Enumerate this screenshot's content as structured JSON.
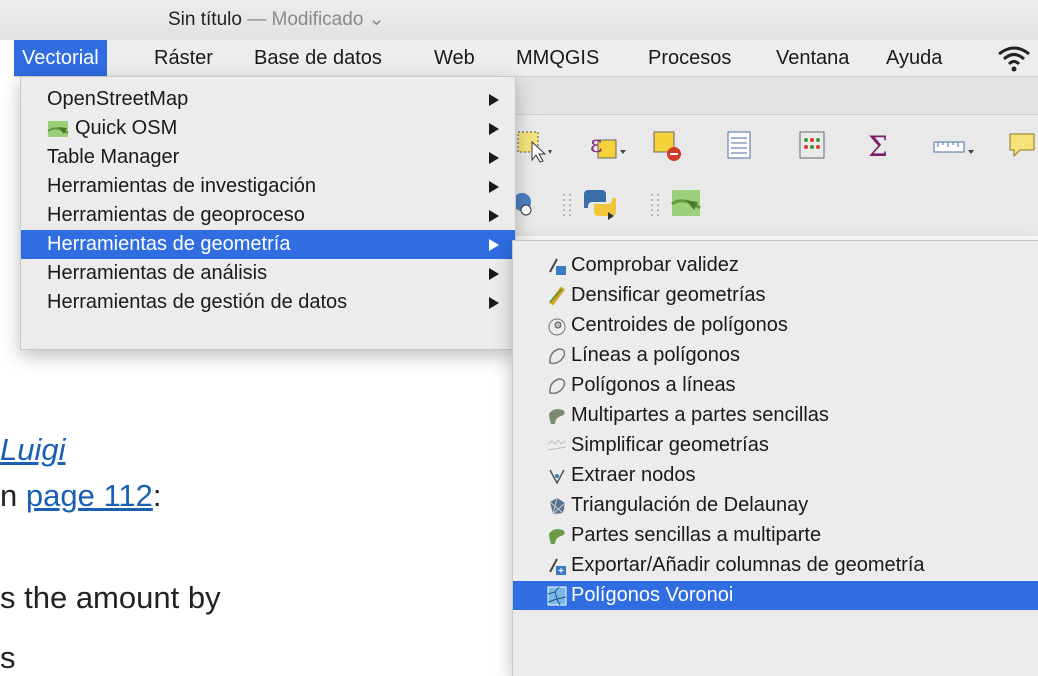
{
  "window": {
    "title": "Sin título",
    "modified": "— Modificado ⌄"
  },
  "menubar": {
    "items": [
      {
        "label": "Vectorial",
        "active": true
      },
      {
        "label": "Ráster"
      },
      {
        "label": "Base de datos"
      },
      {
        "label": "Web"
      },
      {
        "label": "MMQGIS"
      },
      {
        "label": "Procesos"
      },
      {
        "label": "Ventana"
      },
      {
        "label": "Ayuda"
      }
    ]
  },
  "vector_menu": {
    "items": [
      {
        "label": "OpenStreetMap",
        "submenu": true
      },
      {
        "label": "Quick OSM",
        "submenu": true,
        "icon": "quick-osm-icon"
      },
      {
        "label": "Table Manager",
        "submenu": true
      },
      {
        "label": "Herramientas de investigación",
        "submenu": true
      },
      {
        "label": "Herramientas de geoproceso",
        "submenu": true
      },
      {
        "label": "Herramientas de geometría",
        "submenu": true,
        "active": true
      },
      {
        "label": "Herramientas de análisis",
        "submenu": true
      },
      {
        "label": "Herramientas de gestión de datos",
        "submenu": true
      }
    ]
  },
  "geometry_submenu": {
    "items": [
      {
        "label": "Comprobar validez",
        "icon": "check-validity-icon"
      },
      {
        "label": "Densificar geometrías",
        "icon": "densify-icon"
      },
      {
        "label": "Centroides de polígonos",
        "icon": "centroid-icon"
      },
      {
        "label": "Líneas a polígonos",
        "icon": "lines-to-polygons-icon"
      },
      {
        "label": "Polígonos a líneas",
        "icon": "polygons-to-lines-icon"
      },
      {
        "label": "Multipartes a partes sencillas",
        "icon": "multipart-icon"
      },
      {
        "label": "Simplificar geometrías",
        "icon": "simplify-icon"
      },
      {
        "label": "Extraer nodos",
        "icon": "extract-nodes-icon"
      },
      {
        "label": "Triangulación de Delaunay",
        "icon": "delaunay-icon"
      },
      {
        "label": "Partes sencillas a multiparte",
        "icon": "singleparts-icon"
      },
      {
        "label": "Exportar/Añadir columnas de geometría",
        "icon": "export-geometry-columns-icon"
      },
      {
        "label": "Polígonos Voronoi",
        "icon": "voronoi-icon",
        "active": true
      }
    ]
  },
  "background_page": {
    "link_name": "Luigi",
    "prefix_page": "n",
    "page_link": "page 112",
    "page_suffix": ":",
    "text_line": "s the amount by"
  },
  "colors": {
    "accent": "#2f6de1",
    "menu_bg": "#ececec",
    "link": "#1a5fb4"
  }
}
